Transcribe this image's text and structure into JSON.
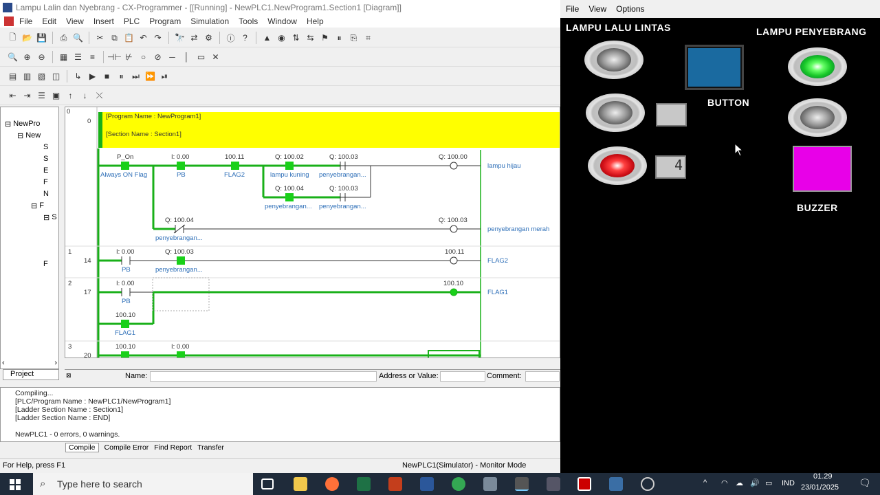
{
  "cx": {
    "title": "Lampu Lalin dan Nyebrang - CX-Programmer - [[Running] - NewPLC1.NewProgram1.Section1 [Diagram]]",
    "menu": [
      "File",
      "Edit",
      "View",
      "Insert",
      "PLC",
      "Program",
      "Simulation",
      "Tools",
      "Window",
      "Help"
    ],
    "tree": [
      "NewPro",
      "New",
      "S",
      "S",
      "E",
      "F",
      "N",
      "F",
      "S",
      "F"
    ],
    "tree_tab": "Project",
    "ladder": {
      "header_rung": "0",
      "header_step": "0",
      "program_name": "[Program Name : NewProgram1]",
      "section_name": "[Section Name : Section1]",
      "rungs": [
        {
          "num": "1",
          "step": "14"
        },
        {
          "num": "2",
          "step": "17"
        },
        {
          "num": "3",
          "step": "20"
        }
      ],
      "elements": {
        "p_on": "P_On",
        "p_on_c": "Always ON Flag",
        "i000": "I: 0.00",
        "pb": "PB",
        "f10011": "100.11",
        "flag2": "FLAG2",
        "q10002": "Q: 100.02",
        "lampu_kuning": "lampu kuning",
        "q10003": "Q: 100.03",
        "peny": "penyebrangan...",
        "q10000": "Q: 100.00",
        "lampu_hijau": "lampu hijau",
        "q10004": "Q: 100.04",
        "peny_merah": "penyebrangan merah",
        "f10010": "100.10",
        "flag1": "FLAG1"
      }
    },
    "foot": {
      "name": "Name:",
      "addr": "Address or Value:",
      "comment": "Comment:"
    },
    "output": [
      "Compiling...",
      "[PLC/Program Name : NewPLC1/NewProgram1]",
      "[Ladder Section Name : Section1]",
      "[Ladder Section Name : END]",
      "NewPLC1 - 0 errors, 0 warnings."
    ],
    "output_tabs": [
      "Compile",
      "Compile Error",
      "Find Report",
      "Transfer"
    ],
    "status_help": "For Help, press F1",
    "status_mode": "NewPLC1(Simulator) - Monitor Mode"
  },
  "panel": {
    "menu": [
      "File",
      "View",
      "Options"
    ],
    "title_left": "LAMPU LALU LINTAS",
    "title_right": "LAMPU PENYEBRANG",
    "button_label": "BUTTON",
    "buzzer_label": "BUZZER",
    "counter": "4",
    "colors": {
      "red": "#d01018",
      "green": "#19c829",
      "button": "#1a6aa0",
      "buzzer": "#e800e8"
    }
  },
  "taskbar": {
    "search_placeholder": "Type here to search",
    "lang": "IND",
    "time": "01.29",
    "date": "23/01/2025"
  }
}
